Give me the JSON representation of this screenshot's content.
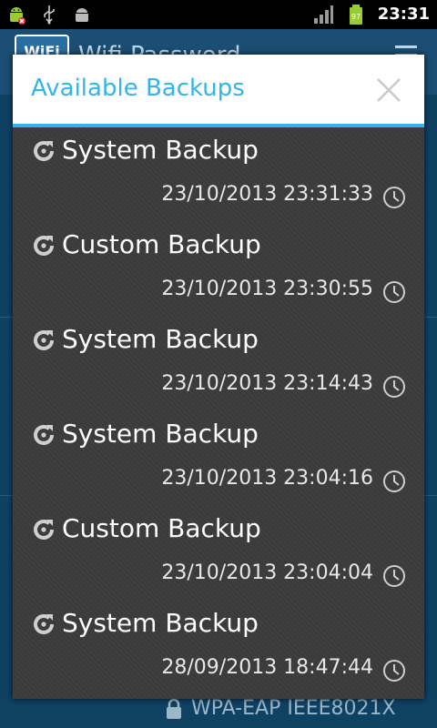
{
  "status_bar": {
    "time": "23:31",
    "icons": [
      "android-usb-icon",
      "usb-icon",
      "android-icon",
      "signal-icon",
      "battery-icon"
    ],
    "battery_level": "97"
  },
  "background_app": {
    "logo_text": "WiFi",
    "title": "Wifi Password",
    "footer_text": "WPA-EAP IEEE8021X"
  },
  "dialog": {
    "title": "Available Backups",
    "close_icon": "close-icon",
    "accent_color": "#33b5e5",
    "items": [
      {
        "name": "System Backup",
        "date": "23/10/2013 23:31:33"
      },
      {
        "name": "Custom Backup",
        "date": "23/10/2013 23:30:55"
      },
      {
        "name": "System Backup",
        "date": "23/10/2013 23:14:43"
      },
      {
        "name": "System Backup",
        "date": "23/10/2013 23:04:16"
      },
      {
        "name": "Custom Backup",
        "date": "23/10/2013 23:04:04"
      },
      {
        "name": "System Backup",
        "date": "28/09/2013 18:47:44"
      }
    ]
  }
}
